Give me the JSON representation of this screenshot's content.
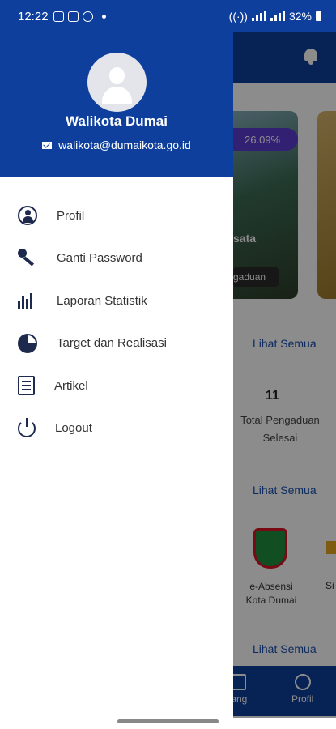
{
  "status_bar": {
    "time": "12:22",
    "battery": "32%"
  },
  "drawer": {
    "user_name": "Walikota Dumai",
    "user_email": "walikota@dumaikota.go.id",
    "menu": [
      {
        "label": "Profil",
        "icon": "user-circle-icon"
      },
      {
        "label": "Ganti Password",
        "icon": "key-icon"
      },
      {
        "label": "Laporan Statistik",
        "icon": "bar-chart-icon"
      },
      {
        "label": "Target dan Realisasi",
        "icon": "pie-chart-icon"
      },
      {
        "label": "Artikel",
        "icon": "article-icon"
      },
      {
        "label": "Logout",
        "icon": "power-icon"
      }
    ]
  },
  "background": {
    "badge": "26.09%",
    "card_text": "sata",
    "card_button": "gaduan",
    "see_all": "Lihat Semua",
    "stat_value": "11",
    "stat_label": "Total Pengaduan Selesai",
    "app_label": "e-Absensi Kota Dumai",
    "app_label_2": "Si",
    "nav_left": "tang",
    "nav_profile": "Profil"
  }
}
